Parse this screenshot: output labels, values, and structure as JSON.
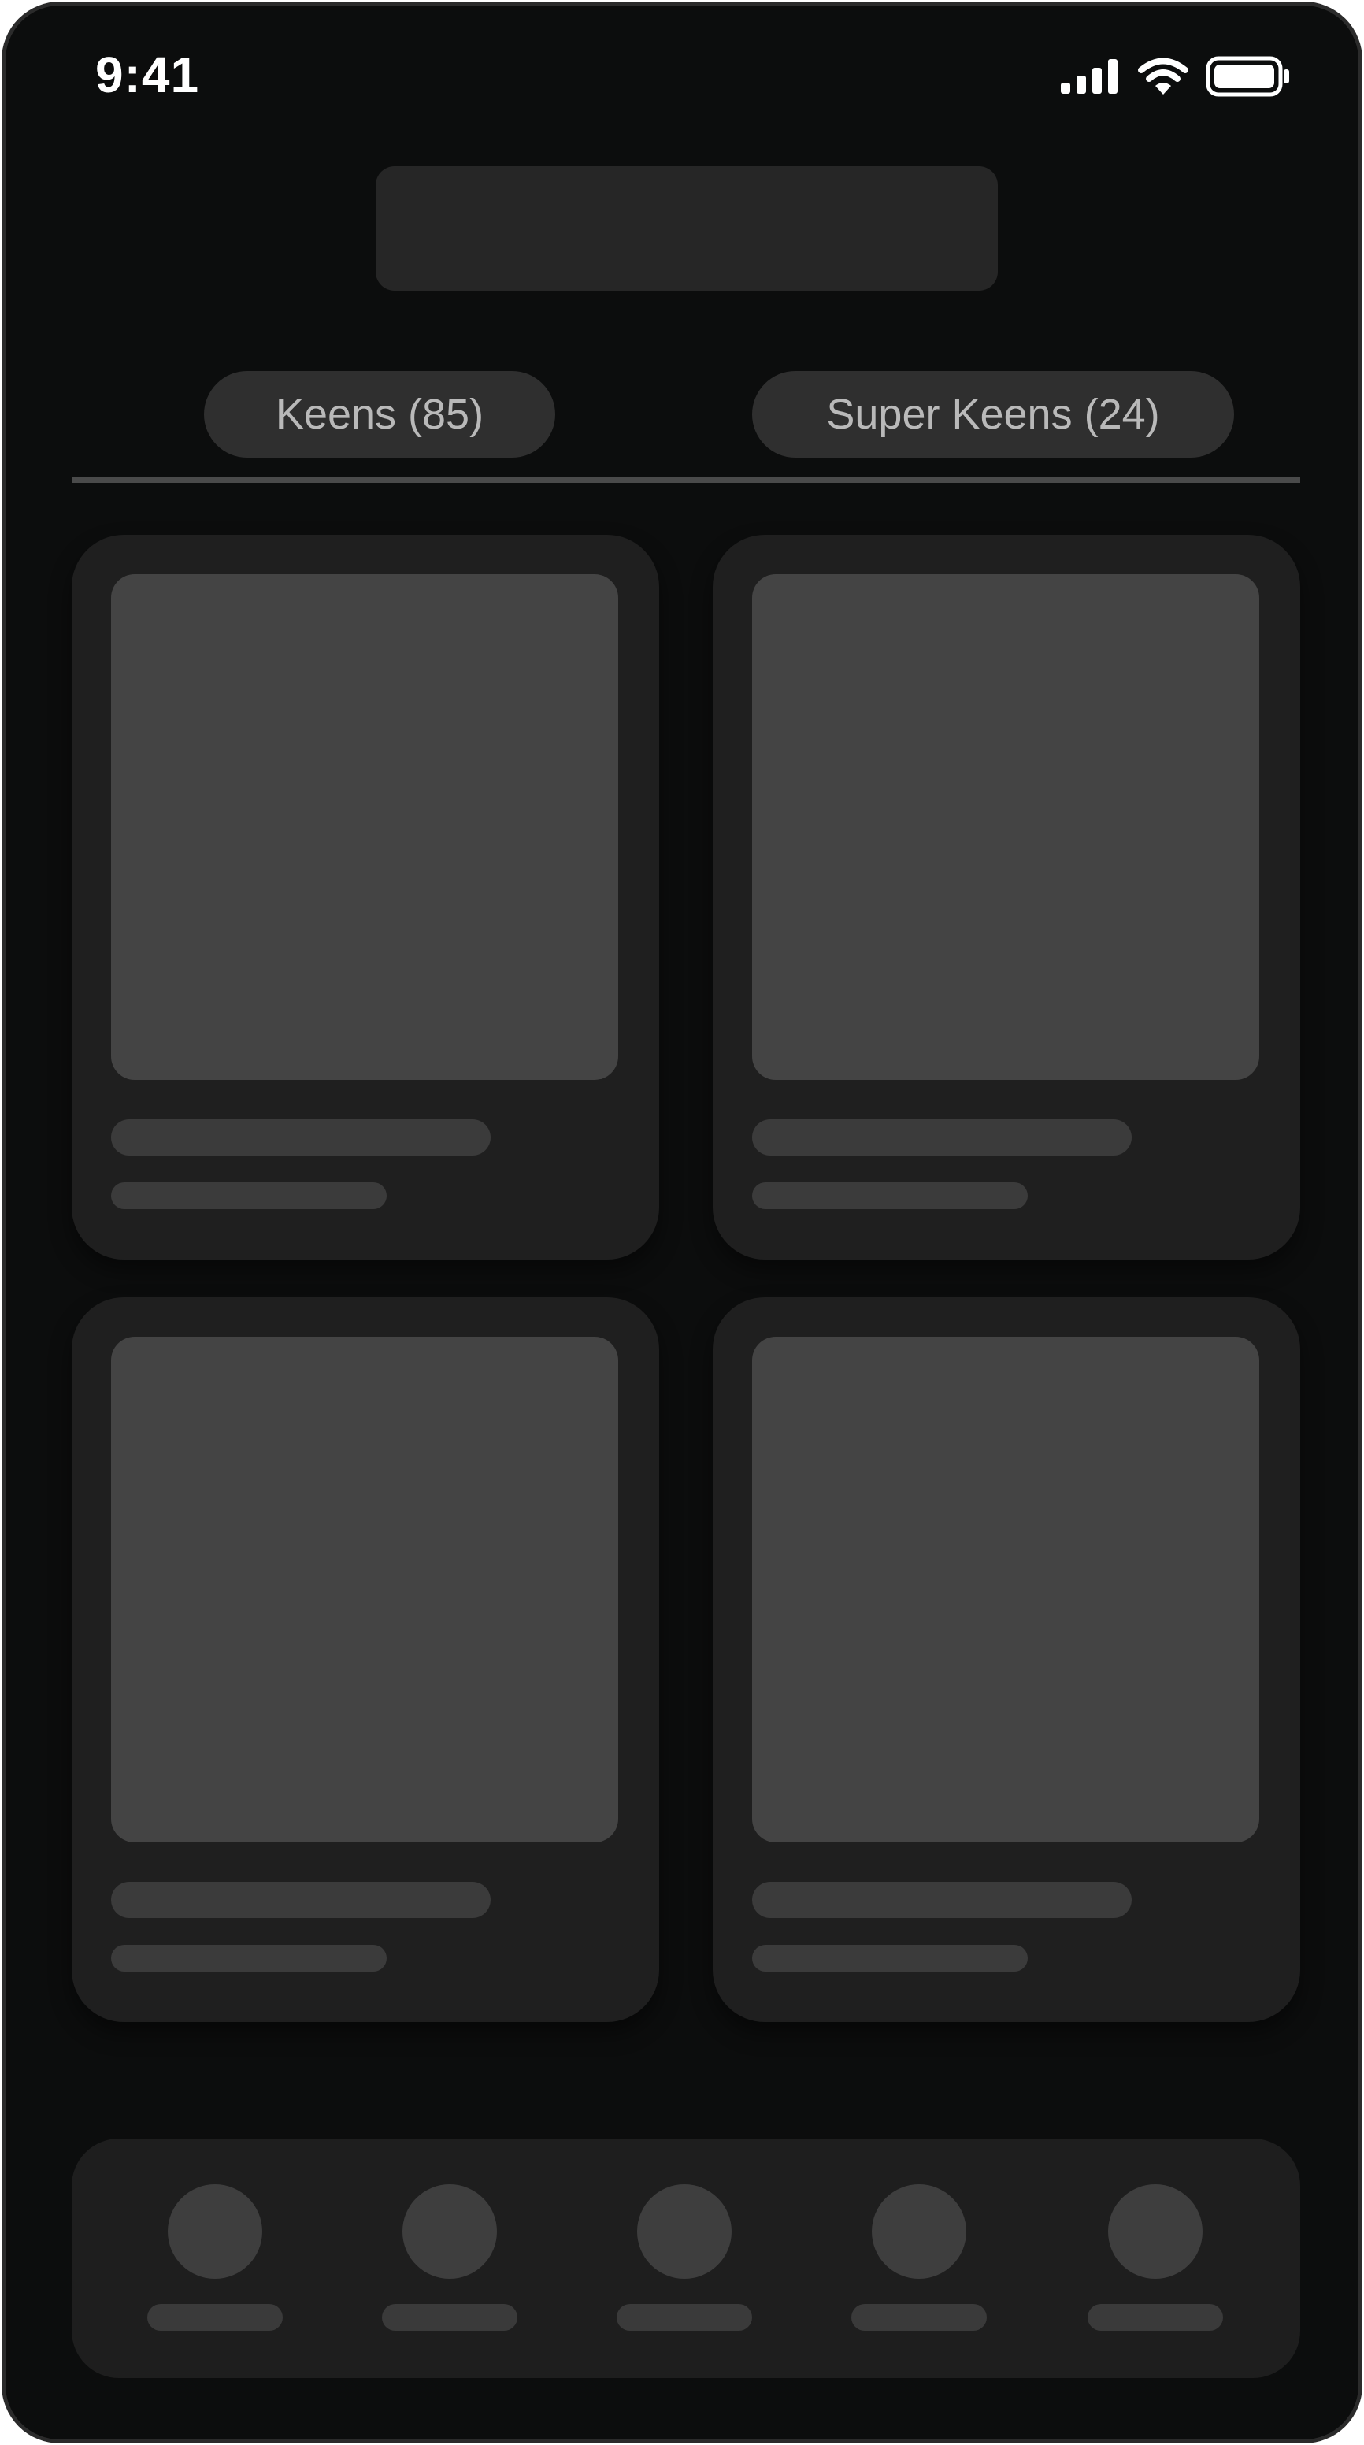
{
  "status_bar": {
    "time": "9:41",
    "icons": [
      "cellular-signal-icon",
      "wifi-icon",
      "battery-icon"
    ]
  },
  "tabs": [
    {
      "label": "Keens (85)",
      "selected": false
    },
    {
      "label": "Super Keens (24)",
      "selected": false
    }
  ],
  "cards": [
    {
      "kind": "skeleton"
    },
    {
      "kind": "skeleton"
    },
    {
      "kind": "skeleton"
    },
    {
      "kind": "skeleton"
    }
  ],
  "bottom_nav": {
    "item_count": 5
  },
  "colors": {
    "background": "#0c0d0d",
    "card": "#1f1f1f",
    "placeholder": "#444444",
    "tab_fill": "#2f2f2f",
    "tab_text": "#b9b9b9"
  }
}
